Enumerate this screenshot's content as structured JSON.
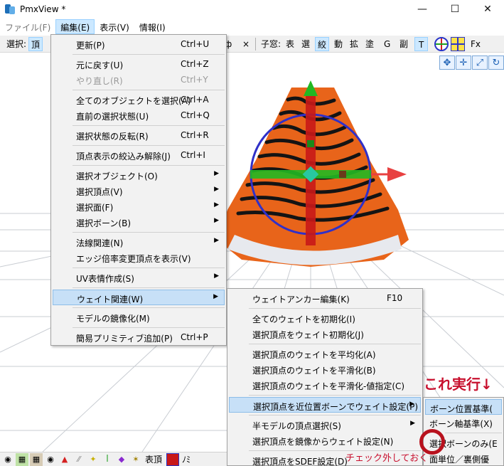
{
  "window": {
    "title": "PmxView *",
    "minimize": "—",
    "maximize": "☐",
    "close": "✕"
  },
  "menubar": [
    "ファイル(F)",
    "編集(E)",
    "表示(V)",
    "情報(I)"
  ],
  "toolbar": {
    "select_label": "選択:",
    "select_vertex": "頂",
    "items_right": [
      "ф",
      "×",
      "子窓:",
      "表",
      "選",
      "絞",
      "動",
      "拡",
      "塗",
      "G",
      "副",
      "T"
    ],
    "fx": "Fx"
  },
  "edit_menu": [
    {
      "label": "更新(P)",
      "shortcut": "Ctrl+U"
    },
    {
      "sep": true
    },
    {
      "label": "元に戻す(U)",
      "shortcut": "Ctrl+Z"
    },
    {
      "label": "やり直し(R)",
      "shortcut": "Ctrl+Y",
      "disabled": true
    },
    {
      "sep": true
    },
    {
      "label": "全てのオブジェクトを選択(A)",
      "shortcut": "Ctrl+A"
    },
    {
      "label": "直前の選択状態(U)",
      "shortcut": "Ctrl+Q"
    },
    {
      "sep": true
    },
    {
      "label": "選択状態の反転(R)",
      "shortcut": "Ctrl+R"
    },
    {
      "sep": true
    },
    {
      "label": "頂点表示の絞込み解除(J)",
      "shortcut": "Ctrl+I"
    },
    {
      "sep": true
    },
    {
      "label": "選択オブジェクト(O)",
      "submenu": true
    },
    {
      "label": "選択頂点(V)",
      "submenu": true
    },
    {
      "label": "選択面(F)",
      "submenu": true
    },
    {
      "label": "選択ボーン(B)",
      "submenu": true
    },
    {
      "sep": true
    },
    {
      "label": "法線関連(N)",
      "submenu": true
    },
    {
      "label": "エッジ倍率変更頂点を表示(V)"
    },
    {
      "sep": true
    },
    {
      "label": "UV表情作成(S)",
      "submenu": true
    },
    {
      "sep": true
    },
    {
      "label": "ウェイト関連(W)",
      "submenu": true,
      "highlighted": true
    },
    {
      "sep": true
    },
    {
      "label": "モデルの鏡像化(M)"
    },
    {
      "sep": true
    },
    {
      "label": "簡易プリミティブ追加(P)",
      "shortcut": "Ctrl+P"
    }
  ],
  "weight_menu": [
    {
      "label": "ウェイトアンカー編集(K)",
      "shortcut": "F10"
    },
    {
      "sep": true
    },
    {
      "label": "全てのウェイトを初期化(I)"
    },
    {
      "label": "選択頂点をウェイト初期化(J)"
    },
    {
      "sep": true
    },
    {
      "label": "選択頂点のウェイトを平均化(A)"
    },
    {
      "label": "選択頂点のウェイトを平滑化(B)"
    },
    {
      "label": "選択頂点のウェイトを平滑化-値指定(C)"
    },
    {
      "sep": true
    },
    {
      "label": "選択頂点を近位置ボーンでウェイト設定(P)",
      "submenu": true,
      "highlighted": true
    },
    {
      "sep": true
    },
    {
      "label": "半モデルの頂点選択(S)",
      "submenu": true
    },
    {
      "label": "選択頂点を鏡像からウェイト設定(N)"
    },
    {
      "sep": true
    },
    {
      "label": "選択頂点をSDEF設定(D)"
    }
  ],
  "bone_menu": [
    {
      "label": "ボーン位置基準(",
      "highlighted": true
    },
    {
      "label": "ボーン軸基準(X)"
    },
    {
      "sep": true
    },
    {
      "label": "選択ボーンのみ(E"
    },
    {
      "label": "面単位／裏側優"
    }
  ],
  "annotation_main": "これ実行↓",
  "annotation_check": "チェック外しておく",
  "statusbar": {
    "items": [
      "表頂"
    ],
    "tail": "ﾉﾐ"
  },
  "colors": {
    "mesh_orange": "#e8641a",
    "mesh_dark": "#1a1a1a",
    "ring_red": "#b8121e",
    "annot_red": "#c8102e",
    "gizmo_blue": "#3030c8",
    "gizmo_green": "#22b822"
  }
}
